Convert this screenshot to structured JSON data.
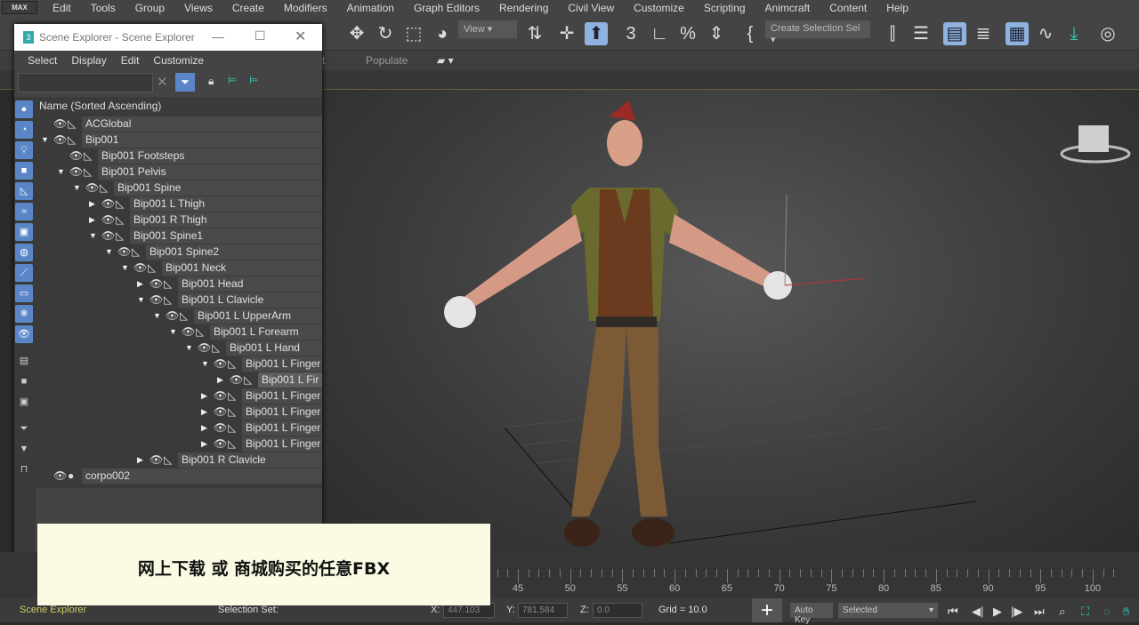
{
  "menubar": {
    "logo": "MAX",
    "items": [
      "Edit",
      "Tools",
      "Group",
      "Views",
      "Create",
      "Modifiers",
      "Animation",
      "Graph Editors",
      "Rendering",
      "Civil View",
      "Customize",
      "Scripting",
      "Animcraft",
      "Content",
      "Help"
    ]
  },
  "toolbar": {
    "view_dropdown": "View",
    "selection_set": "Create Selection Sel"
  },
  "ribbon": {
    "tab_partial": "t",
    "populate": "Populate"
  },
  "scene_explorer": {
    "title": "Scene Explorer - Scene Explorer",
    "menu": [
      "Select",
      "Display",
      "Edit",
      "Customize"
    ],
    "search_placeholder": "",
    "column_header": "Name (Sorted Ascending)",
    "tree": [
      {
        "label": "ACGlobal",
        "level": 0,
        "arrow": "none",
        "icon": "bone"
      },
      {
        "label": "Bip001",
        "level": 0,
        "arrow": "down",
        "icon": "bone"
      },
      {
        "label": "Bip001 Footsteps",
        "level": 1,
        "arrow": "none",
        "icon": "bone"
      },
      {
        "label": "Bip001 Pelvis",
        "level": 1,
        "arrow": "down",
        "icon": "bone"
      },
      {
        "label": "Bip001 Spine",
        "level": 2,
        "arrow": "down",
        "icon": "bone"
      },
      {
        "label": "Bip001 L Thigh",
        "level": 3,
        "arrow": "right",
        "icon": "bone"
      },
      {
        "label": "Bip001 R Thigh",
        "level": 3,
        "arrow": "right",
        "icon": "bone"
      },
      {
        "label": "Bip001 Spine1",
        "level": 3,
        "arrow": "down",
        "icon": "bone"
      },
      {
        "label": "Bip001 Spine2",
        "level": 4,
        "arrow": "down",
        "icon": "bone"
      },
      {
        "label": "Bip001 Neck",
        "level": 5,
        "arrow": "down",
        "icon": "bone"
      },
      {
        "label": "Bip001 Head",
        "level": 6,
        "arrow": "right",
        "icon": "bone"
      },
      {
        "label": "Bip001 L Clavicle",
        "level": 6,
        "arrow": "down",
        "icon": "bone"
      },
      {
        "label": "Bip001 L UpperArm",
        "level": 7,
        "arrow": "down",
        "icon": "bone"
      },
      {
        "label": "Bip001 L Forearm",
        "level": 8,
        "arrow": "down",
        "icon": "bone"
      },
      {
        "label": "Bip001 L Hand",
        "level": 9,
        "arrow": "down",
        "icon": "bone"
      },
      {
        "label": "Bip001 L Finger",
        "level": 10,
        "arrow": "down",
        "icon": "bone"
      },
      {
        "label": "Bip001 L Fir",
        "level": 11,
        "arrow": "right",
        "icon": "bone",
        "selected": true
      },
      {
        "label": "Bip001 L Finger",
        "level": 10,
        "arrow": "right",
        "icon": "bone"
      },
      {
        "label": "Bip001 L Finger",
        "level": 10,
        "arrow": "right",
        "icon": "bone"
      },
      {
        "label": "Bip001 L Finger",
        "level": 10,
        "arrow": "right",
        "icon": "bone"
      },
      {
        "label": "Bip001 L Finger",
        "level": 10,
        "arrow": "right",
        "icon": "bone"
      },
      {
        "label": "Bip001 R Clavicle",
        "level": 6,
        "arrow": "right",
        "icon": "bone"
      },
      {
        "label": "corpo002",
        "level": 0,
        "arrow": "none",
        "icon": "sphere"
      }
    ]
  },
  "caption": "网上下载 或 商城购买的任意FBX",
  "timeline": {
    "ticks": [
      45,
      50,
      55,
      60,
      65,
      70,
      75,
      80,
      85,
      90,
      95,
      100
    ]
  },
  "status": {
    "scene_explorer_label": "Scene Explorer",
    "selection_set": "Selection Set:",
    "x_label": "X:",
    "x_value": "447.103",
    "y_label": "Y:",
    "y_value": "781.584",
    "z_label": "Z:",
    "z_value": "0.0",
    "grid": "Grid = 10.0",
    "auto_key": "Auto Key",
    "key_mode": "Selected"
  }
}
